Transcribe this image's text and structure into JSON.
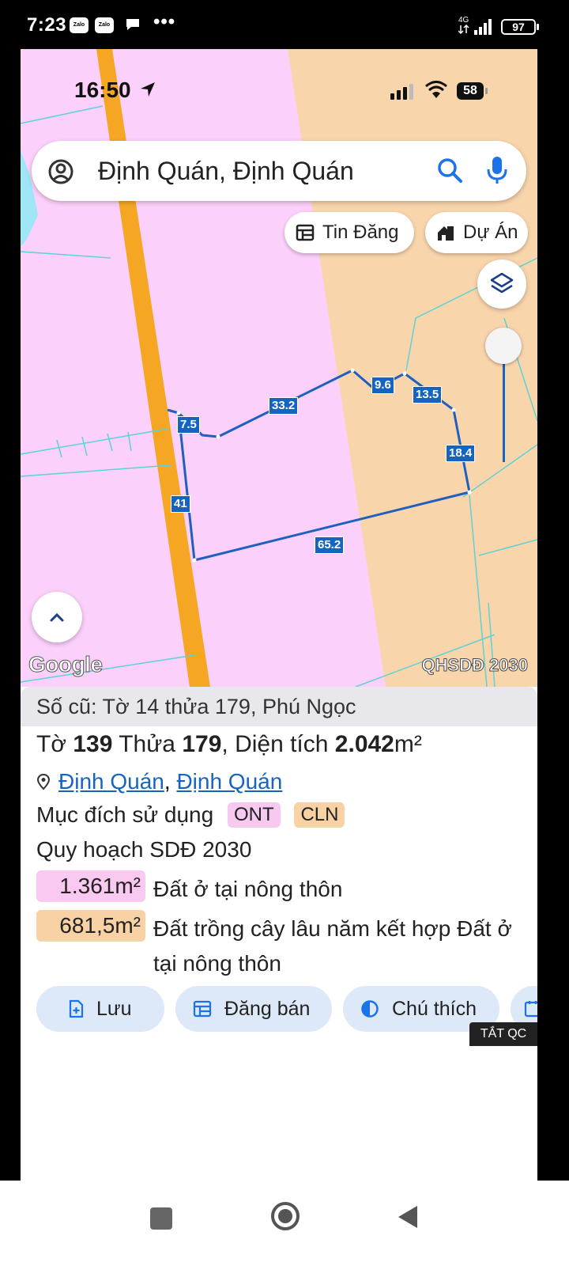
{
  "android_status": {
    "time": "7:23",
    "notif_apps": [
      "Zalo",
      "Zalo"
    ],
    "more": "•••",
    "network": "4G",
    "battery": "97"
  },
  "ios_status": {
    "time": "16:50",
    "battery": "58"
  },
  "search": {
    "query": "Định Quán, Định Quán",
    "icons": [
      "account-circle-icon",
      "search-icon",
      "mic-icon"
    ]
  },
  "chips": {
    "tin_dang": "Tin Đăng",
    "du_an": "Dự Án"
  },
  "map": {
    "segment_lengths": [
      "7.5",
      "33.2",
      "9.6",
      "13.5",
      "18.4",
      "41",
      "65.2"
    ],
    "google_logo": "Google",
    "overlay_label": "QHSDĐ 2030",
    "colors": {
      "residential_zone": "#fbd0fa",
      "perennial_zone": "#f9d5ac",
      "road": "#f5a623",
      "parcel_outline": "#1f5fbf",
      "parcel_lines": "#5ed2d6"
    }
  },
  "parcel": {
    "old_number": "Số cũ: Tờ 14 thửa 179, Phú Ngọc",
    "sheet_label": "Tờ",
    "sheet_no": "139",
    "parcel_label": "Thửa",
    "parcel_no": "179",
    "area_label": "Diện tích",
    "area_value": "2.042",
    "area_unit": "m²",
    "location_1": "Định Quán",
    "location_2": "Định Quán",
    "purpose_label": "Mục đích sử dụng",
    "purpose_tags": [
      "ONT",
      "CLN"
    ],
    "plan_label": "Quy hoạch SDĐ 2030",
    "plan_items": [
      {
        "area": "1.361m²",
        "desc": "Đất ở tại nông thôn"
      },
      {
        "area": "681,5m²",
        "desc": "Đất trồng cây lâu năm kết hợp Đất ở tại nông thôn"
      }
    ]
  },
  "actions": {
    "save": "Lưu",
    "post_sale": "Đăng bán",
    "legend": "Chú thích"
  },
  "ad_off": "TẮT QC"
}
